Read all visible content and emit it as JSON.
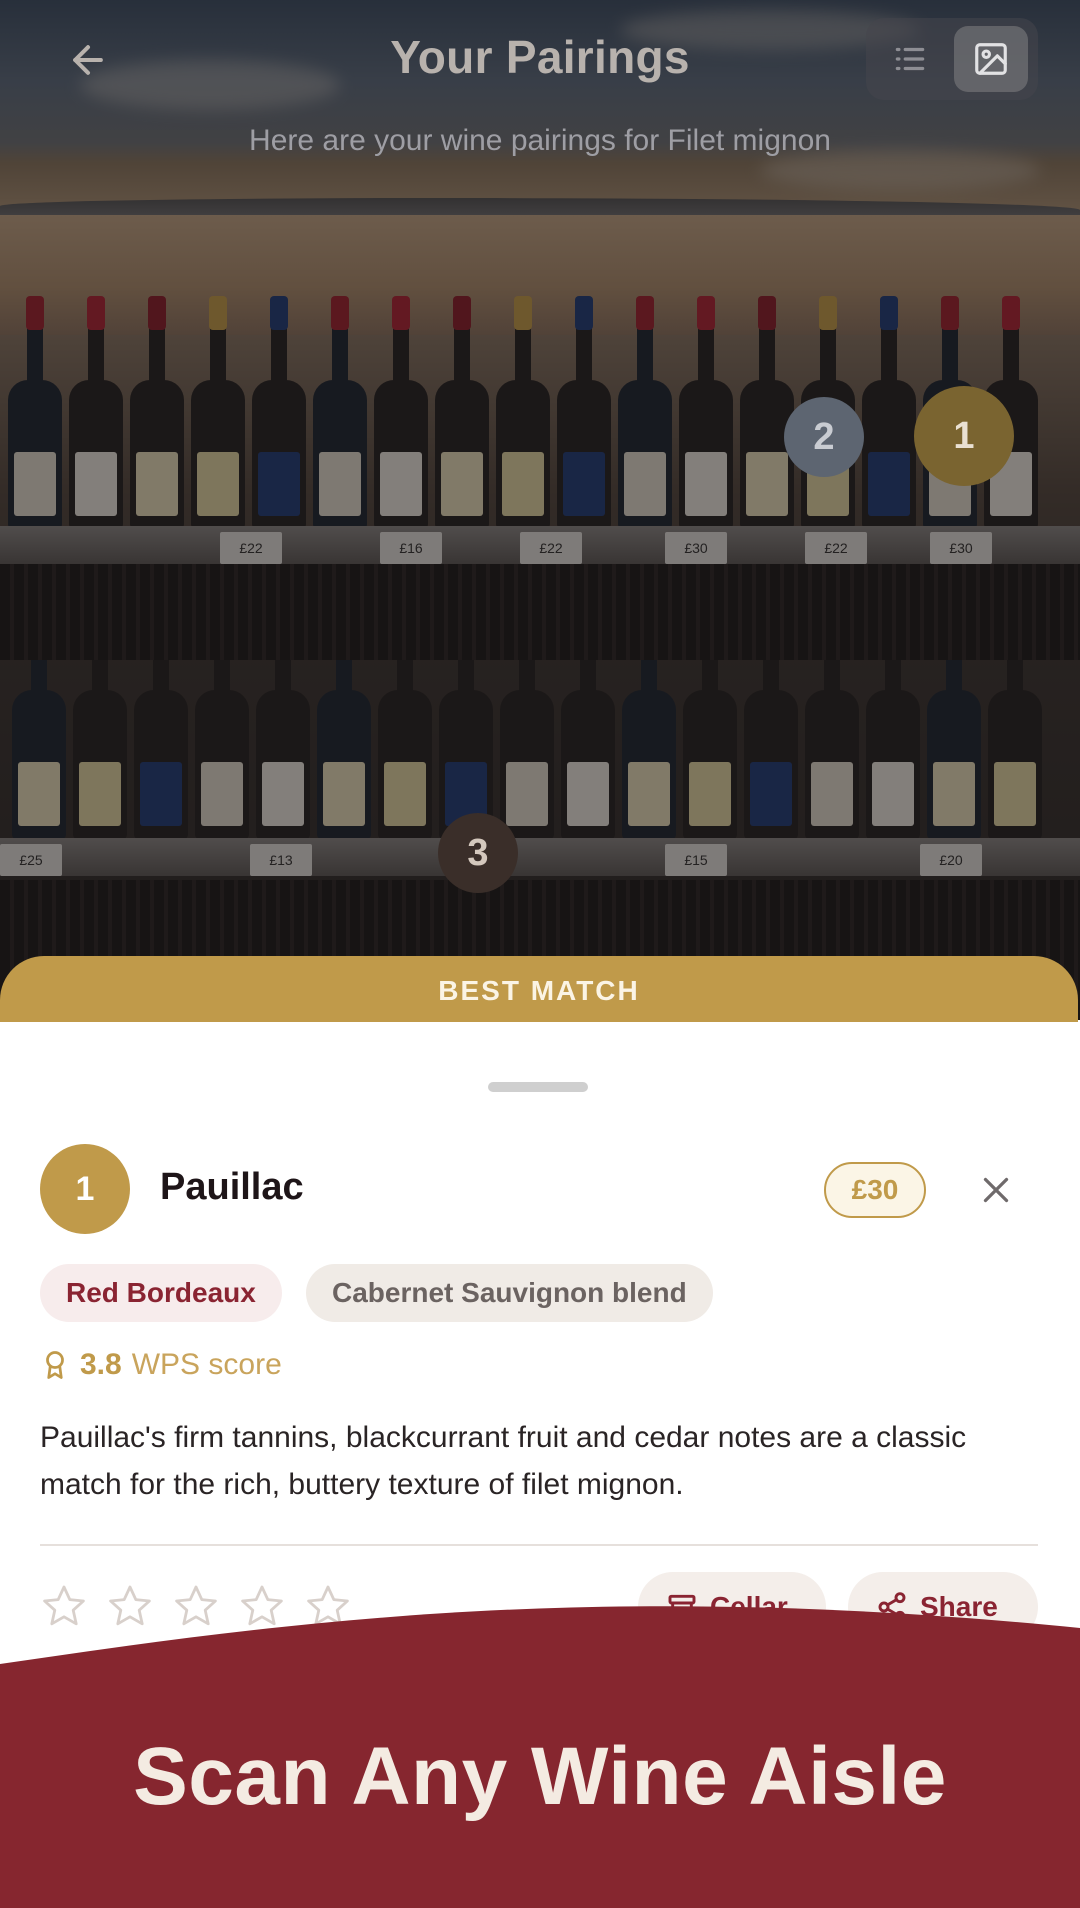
{
  "header": {
    "title": "Your Pairings",
    "subtitle": "Here are your wine pairings for Filet mignon",
    "back_icon": "arrow-left-icon",
    "view_toggle": {
      "list_icon": "list-icon",
      "image_icon": "image-icon",
      "selected": "image"
    }
  },
  "markers": [
    {
      "label": "1"
    },
    {
      "label": "2"
    },
    {
      "label": "3"
    }
  ],
  "best_match": {
    "label": "BEST MATCH"
  },
  "card": {
    "rank": "1",
    "name": "Pauillac",
    "price": "£30",
    "tags": [
      "Red Bordeaux",
      "Cabernet Sauvignon blend"
    ],
    "score_value": "3.8",
    "score_label": "WPS score",
    "description": "Pauillac's firm tannins, blackcurrant fruit and cedar notes are a classic match for the rich, buttery texture of filet mignon.",
    "rating": 0,
    "rating_max": 5,
    "cellar_label": "Cellar",
    "share_label": "Share"
  },
  "promo": {
    "text": "Scan Any Wine Aisle"
  },
  "colors": {
    "gold": "#c09a4a",
    "wine_red": "#8a2432",
    "promo_red": "#86262f"
  },
  "price_tags_on_shelf": [
    "£22",
    "£16",
    "£22",
    "£30",
    "£22",
    "£30",
    "£25",
    "£13",
    "£15",
    "£20"
  ]
}
